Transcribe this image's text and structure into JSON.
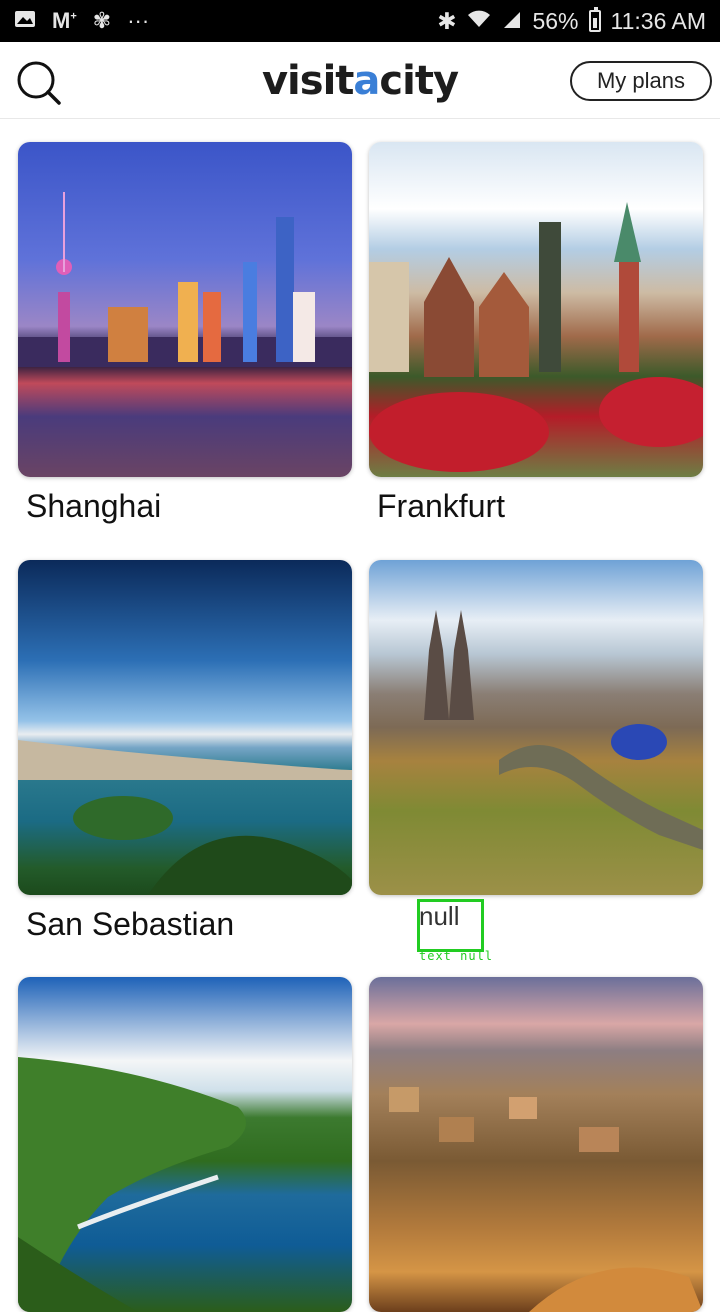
{
  "status_bar": {
    "left_icons": [
      "image-icon",
      "gmail-icon",
      "fan-icon",
      "more-icon"
    ],
    "battery_percent": "56%",
    "time": "11:36 AM",
    "right_icons": [
      "bluetooth-icon",
      "wifi-icon",
      "signal-icon",
      "battery-icon"
    ]
  },
  "app_bar": {
    "logo_prefix": "visit",
    "logo_accent": "a",
    "logo_suffix": "city",
    "my_plans_label": "My plans",
    "accent_color": "#3a7fd6"
  },
  "cities": [
    {
      "name": "Shanghai"
    },
    {
      "name": "Frankfurt"
    },
    {
      "name": "San Sebastian"
    },
    {
      "name": "null"
    },
    {
      "name": ""
    },
    {
      "name": ""
    }
  ],
  "debug_overlay": {
    "text": "text null",
    "color": "#22cc22"
  }
}
